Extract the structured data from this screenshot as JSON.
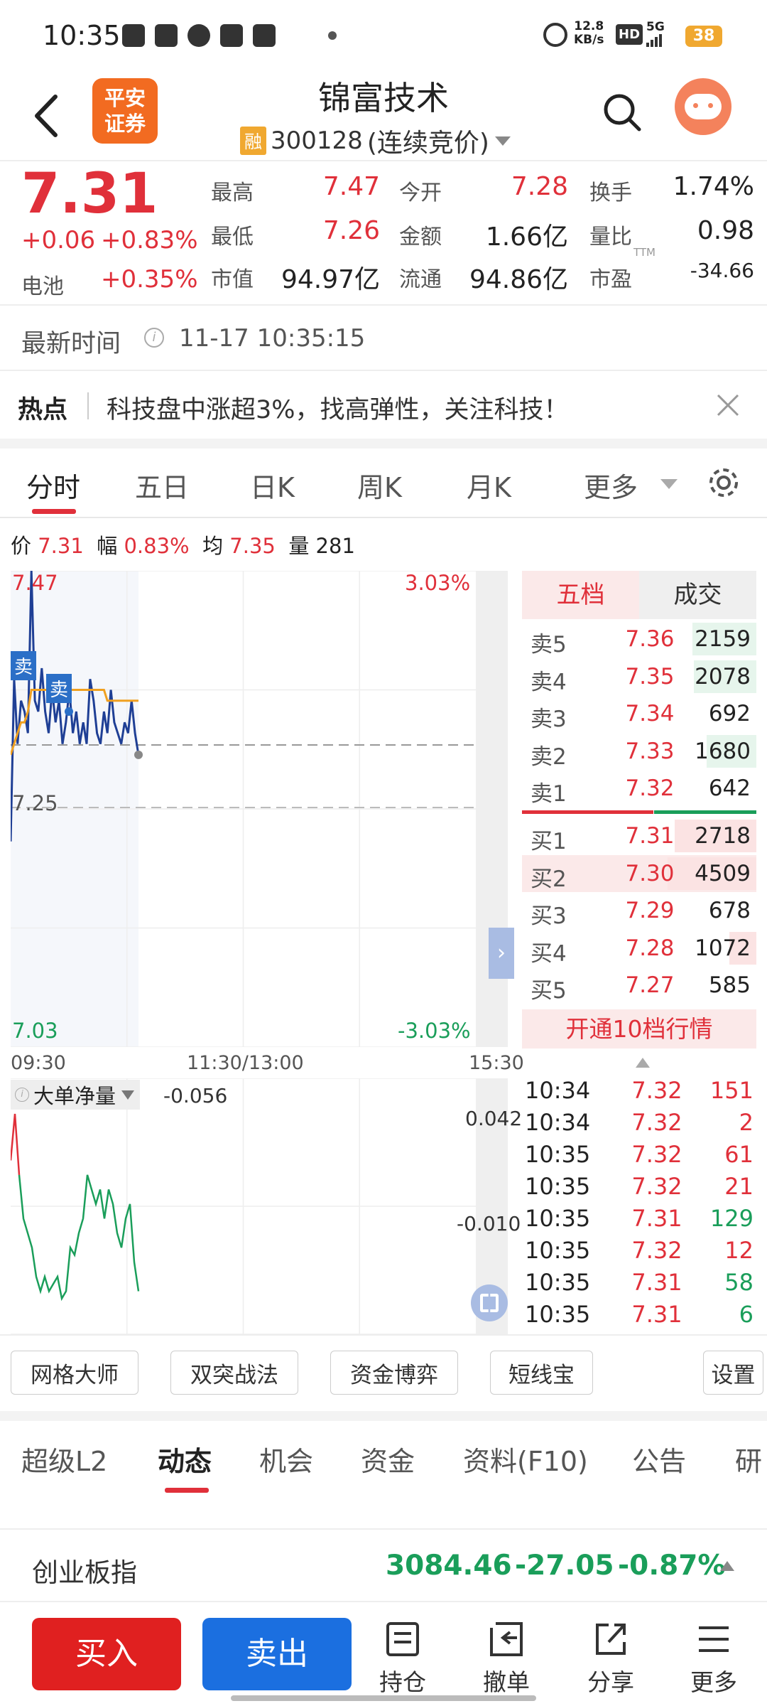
{
  "status": {
    "time": "10:35",
    "speed_top": "12.8",
    "speed_bottom": "KB/s",
    "battery": "38",
    "signal": "5G",
    "hd": "HD"
  },
  "header": {
    "title": "锦富技术",
    "rong": "融",
    "code": "300128",
    "mode": "(连续竞价)",
    "logo_line1": "平安",
    "logo_line2": "证券"
  },
  "quote": {
    "price": "7.31",
    "change": "+0.06",
    "change_pct": "+0.83%",
    "sector_label": "电池",
    "sector_pct": "+0.35%",
    "items": [
      {
        "label": "最高",
        "value": "7.47"
      },
      {
        "label": "今开",
        "value": "7.28"
      },
      {
        "label": "换手",
        "value": "1.74%"
      },
      {
        "label": "最低",
        "value": "7.26"
      },
      {
        "label": "金额",
        "value": "1.66亿"
      },
      {
        "label": "量比",
        "value": "0.98"
      },
      {
        "label": "市值",
        "value": "94.97亿"
      },
      {
        "label": "流通",
        "value": "94.86亿"
      },
      {
        "label": "市盈",
        "value": "-34.66",
        "sup": "TTM"
      }
    ]
  },
  "update": {
    "label": "最新时间",
    "time": "11-17 10:35:15"
  },
  "hot": {
    "label": "热点",
    "text": "科技盘中涨超3%，找高弹性，关注科技！"
  },
  "chart_tabs": [
    "分时",
    "五日",
    "日K",
    "周K",
    "月K",
    "更多"
  ],
  "info_bar": {
    "price_label": "价",
    "price": "7.31",
    "amp_label": "幅",
    "amp": "0.83%",
    "avg_label": "均",
    "avg": "7.35",
    "vol_label": "量",
    "vol": "281"
  },
  "chart_labels": {
    "high": "7.47",
    "high_pct": "3.03%",
    "mid": "7.25",
    "low": "7.03",
    "low_pct": "-3.03%",
    "t_start": "09:30",
    "t_mid": "11:30/13:00",
    "t_end": "15:30",
    "sell_tag": "卖",
    "sell_tag2": "卖"
  },
  "chart_data": {
    "type": "line",
    "series": [
      {
        "values": [
          7.22,
          7.37,
          7.31,
          7.35,
          7.34,
          7.32,
          7.47,
          7.35,
          7.34,
          7.38,
          7.34,
          7.32,
          7.36,
          7.33,
          7.35,
          7.31,
          7.33,
          7.36,
          7.32,
          7.34,
          7.31,
          7.33,
          7.31,
          7.37,
          7.35,
          7.32,
          7.31,
          7.34,
          7.32,
          7.36,
          7.33,
          7.32,
          7.31,
          7.33,
          7.32,
          7.35,
          7.32,
          7.3
        ]
      },
      {
        "values": [
          7.3,
          7.31,
          7.32,
          7.33,
          7.33,
          7.34,
          7.36,
          7.36,
          7.36,
          7.36,
          7.36,
          7.36,
          7.36,
          7.36,
          7.36,
          7.36,
          7.36,
          7.36,
          7.36,
          7.36,
          7.36,
          7.36,
          7.36,
          7.36,
          7.36,
          7.36,
          7.36,
          7.36,
          7.35,
          7.35,
          7.35,
          7.35,
          7.35,
          7.35,
          7.35,
          7.35,
          7.35,
          7.35
        ]
      }
    ],
    "ylim": [
      7.03,
      7.47
    ],
    "indicator": {
      "label": "大单净量",
      "value": "-0.056",
      "top": "0.042",
      "mid": "-0.010",
      "values": [
        0.01,
        0.042,
        0.0,
        -0.03,
        -0.04,
        -0.05,
        -0.07,
        -0.08,
        -0.07,
        -0.08,
        -0.075,
        -0.07,
        -0.085,
        -0.08,
        -0.05,
        -0.055,
        -0.04,
        -0.03,
        0.0,
        -0.01,
        -0.02,
        -0.01,
        -0.03,
        -0.01,
        -0.02,
        -0.04,
        -0.05,
        -0.03,
        -0.02,
        -0.06,
        -0.08
      ]
    }
  },
  "orderbook": {
    "tabs": [
      "五档",
      "成交"
    ],
    "asks": [
      {
        "label": "卖5",
        "price": "7.36",
        "vol": "2159",
        "w": 0.72
      },
      {
        "label": "卖4",
        "price": "7.35",
        "vol": "2078",
        "w": 0.7
      },
      {
        "label": "卖3",
        "price": "7.34",
        "vol": "692",
        "w": 0.0
      },
      {
        "label": "卖2",
        "price": "7.33",
        "vol": "1680",
        "w": 0.56
      },
      {
        "label": "卖1",
        "price": "7.32",
        "vol": "642",
        "w": 0.0
      }
    ],
    "bids": [
      {
        "label": "买1",
        "price": "7.31",
        "vol": "2718",
        "w": 0.92
      },
      {
        "label": "买2",
        "price": "7.30",
        "vol": "4509",
        "w": 1.0
      },
      {
        "label": "买3",
        "price": "7.29",
        "vol": "678",
        "w": 0.0
      },
      {
        "label": "买4",
        "price": "7.28",
        "vol": "1072",
        "w": 0.3
      },
      {
        "label": "买5",
        "price": "7.27",
        "vol": "585",
        "w": 0.0
      }
    ],
    "upgrade": "开通10档行情"
  },
  "trades": [
    {
      "t": "10:34",
      "p": "7.32",
      "v": "151",
      "c": "red"
    },
    {
      "t": "10:34",
      "p": "7.32",
      "v": "2",
      "c": "red"
    },
    {
      "t": "10:35",
      "p": "7.32",
      "v": "61",
      "c": "red"
    },
    {
      "t": "10:35",
      "p": "7.32",
      "v": "21",
      "c": "red"
    },
    {
      "t": "10:35",
      "p": "7.31",
      "v": "129",
      "c": "green"
    },
    {
      "t": "10:35",
      "p": "7.32",
      "v": "12",
      "c": "red"
    },
    {
      "t": "10:35",
      "p": "7.31",
      "v": "58",
      "c": "green"
    },
    {
      "t": "10:35",
      "p": "7.31",
      "v": "6",
      "c": "green"
    }
  ],
  "tools": [
    "网格大师",
    "双突战法",
    "资金博弈",
    "短线宝",
    "设置"
  ],
  "bottom_tabs": [
    "超级L2",
    "动态",
    "机会",
    "资金",
    "资料(F10)",
    "公告",
    "研"
  ],
  "index": {
    "name": "创业板指",
    "value": "3084.46",
    "change": "-27.05",
    "pct": "-0.87%"
  },
  "actions": {
    "buy": "买入",
    "sell": "卖出",
    "nav": [
      "持仓",
      "撤单",
      "分享",
      "更多"
    ]
  }
}
